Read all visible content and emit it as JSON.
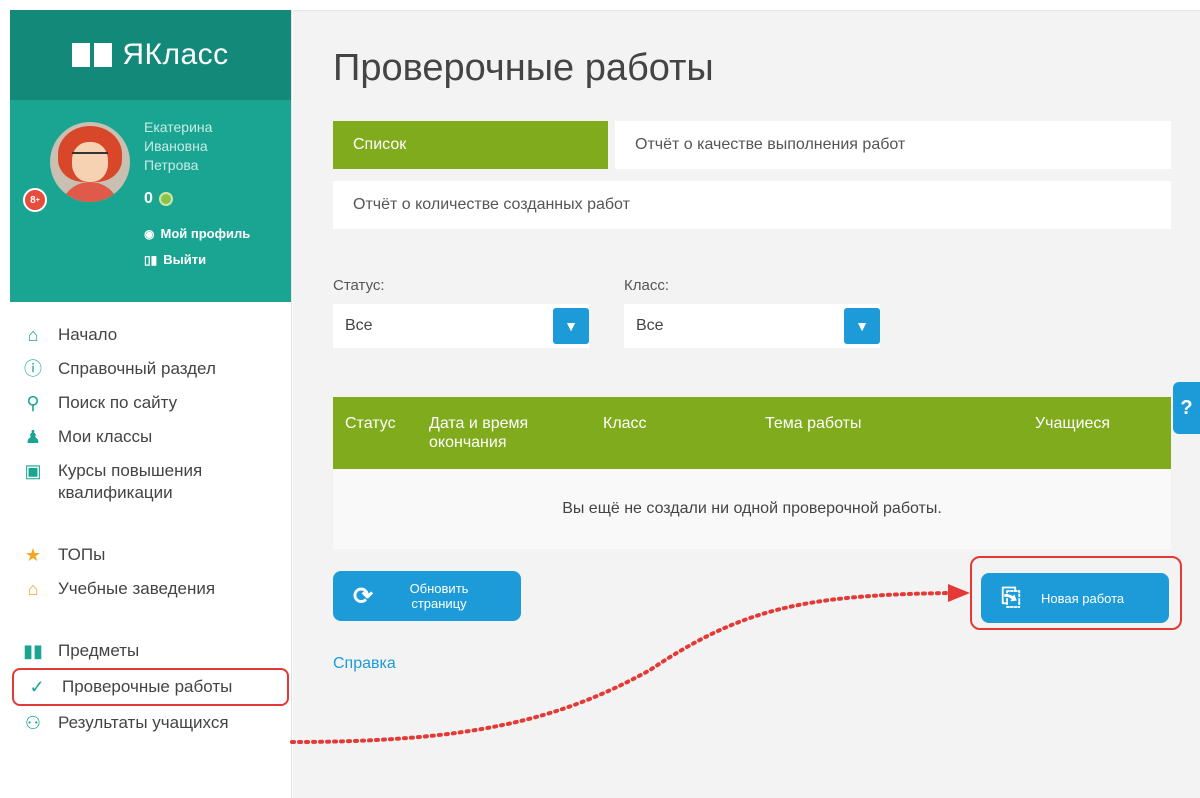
{
  "sidebar": {
    "logo": "ЯКласс",
    "user": {
      "first_name": "Екатерина",
      "middle_name": "Ивановна",
      "last_name": "Петрова",
      "grade_badge": "8",
      "points": "0",
      "my_profile": "Мой профиль",
      "logout": "Выйти"
    },
    "nav": [
      {
        "label": "Начало",
        "icon": "home-icon"
      },
      {
        "label": "Справочный раздел",
        "icon": "help-circle-icon"
      },
      {
        "label": "Поиск по сайту",
        "icon": "search-icon"
      },
      {
        "label": "Мои классы",
        "icon": "class-icon"
      },
      {
        "label": "Курсы повышения квалификации",
        "icon": "course-icon"
      },
      {
        "label": "ТОПы",
        "icon": "star-icon"
      },
      {
        "label": "Учебные заведения",
        "icon": "institution-icon"
      },
      {
        "label": "Предметы",
        "icon": "books-icon"
      },
      {
        "label": "Проверочные работы",
        "icon": "check-circle-icon"
      },
      {
        "label": "Результаты учащихся",
        "icon": "users-icon"
      }
    ]
  },
  "main": {
    "title": "Проверочные работы",
    "tabs": [
      {
        "label": "Список",
        "active": true
      },
      {
        "label": "Отчёт о качестве выполнения работ",
        "active": false
      },
      {
        "label": "Отчёт о количестве созданных работ",
        "active": false
      }
    ],
    "filters": {
      "status_label": "Статус:",
      "status_value": "Все",
      "class_label": "Класс:",
      "class_value": "Все"
    },
    "table": {
      "headers": [
        "Статус",
        "Дата и время окончания",
        "Класс",
        "Тема работы",
        "Учащиеся"
      ],
      "empty_message": "Вы ещё не создали ни одной проверочной работы."
    },
    "refresh_button": "Обновить страницу",
    "new_button": "Новая работа",
    "help_link": "Справка",
    "help_tab": "?"
  },
  "colors": {
    "teal_dark": "#13897a",
    "teal": "#1aa593",
    "green": "#7fab1c",
    "blue": "#1d9bd8",
    "highlight_red": "#e53935"
  }
}
